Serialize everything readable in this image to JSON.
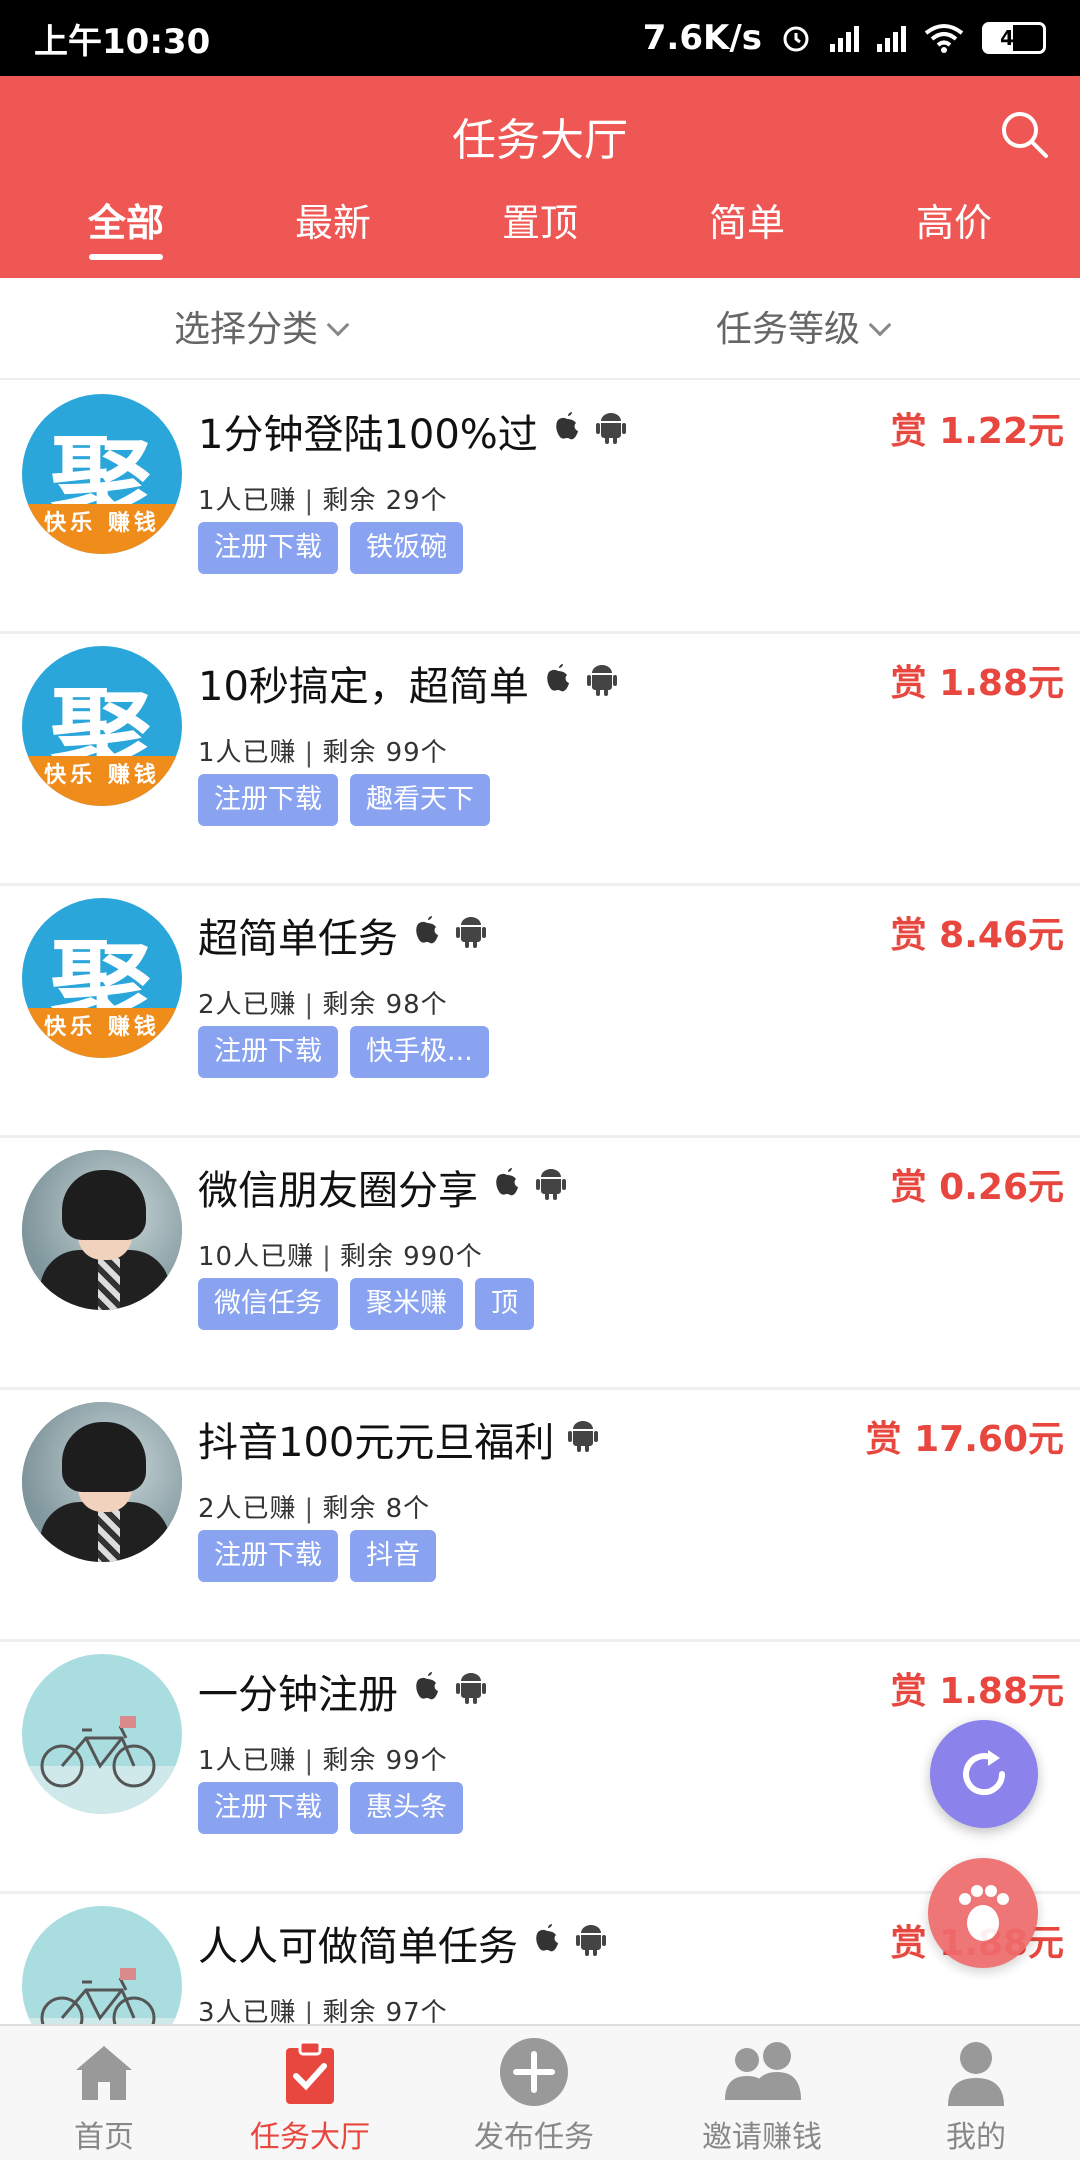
{
  "status_bar": {
    "time": "上午10:30",
    "speed": "7.6K/s",
    "battery": "45"
  },
  "header": {
    "title": "任务大厅"
  },
  "tabs": [
    {
      "label": "全部",
      "active": true
    },
    {
      "label": "最新"
    },
    {
      "label": "置顶"
    },
    {
      "label": "简单"
    },
    {
      "label": "高价"
    }
  ],
  "filters": {
    "category": "选择分类",
    "level": "任务等级"
  },
  "tasks": [
    {
      "title": "1分钟登陆100%过",
      "earned": "1人已赚",
      "remaining": "剩余 29个",
      "tags": [
        "注册下载",
        "铁饭碗"
      ],
      "reward": "赏 1.22元",
      "avatar": "聚",
      "avatar_band": "快乐 赚钱"
    },
    {
      "title": "10秒搞定，超简单",
      "earned": "1人已赚",
      "remaining": "剩余 99个",
      "tags": [
        "注册下载",
        "趣看天下"
      ],
      "reward": "赏 1.88元",
      "avatar": "聚",
      "avatar_band": "快乐 赚钱"
    },
    {
      "title": "超简单任务",
      "earned": "2人已赚",
      "remaining": "剩余 98个",
      "tags": [
        "注册下载",
        "快手极..."
      ],
      "reward": "赏 8.46元",
      "avatar": "聚",
      "avatar_band": "快乐 赚钱"
    },
    {
      "title": "微信朋友圈分享",
      "earned": "10人已赚",
      "remaining": "剩余 990个",
      "tags": [
        "微信任务",
        "聚米赚",
        "顶"
      ],
      "reward": "赏 0.26元"
    },
    {
      "title": "抖音100元元旦福利",
      "earned": "2人已赚",
      "remaining": "剩余 8个",
      "tags": [
        "注册下载",
        "抖音"
      ],
      "reward": "赏 17.60元"
    },
    {
      "title": "一分钟注册",
      "earned": "1人已赚",
      "remaining": "剩余 99个",
      "tags": [
        "注册下载",
        "惠头条"
      ],
      "reward": "赏 1.88元"
    },
    {
      "title": "人人可做简单任务",
      "earned": "3人已赚",
      "remaining": "剩余 97个",
      "tags": [],
      "reward": "赏 1.88元"
    }
  ],
  "bottom_nav": [
    {
      "label": "首页",
      "icon": "home-icon"
    },
    {
      "label": "任务大厅",
      "icon": "clipboard-check-icon",
      "active": true
    },
    {
      "label": "发布任务",
      "icon": "plus-circle-icon"
    },
    {
      "label": "邀请赚钱",
      "icon": "users-icon"
    },
    {
      "label": "我的",
      "icon": "user-icon"
    }
  ],
  "colors": {
    "primary": "#ee5753",
    "reward": "#e8473f",
    "tag": "#8aa3f0",
    "fab_refresh": "#8b82ec"
  }
}
